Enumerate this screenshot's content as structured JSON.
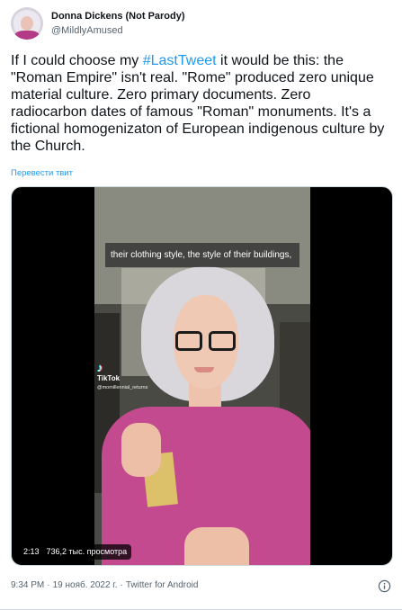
{
  "author": {
    "display_name": "Donna Dickens (Not Parody)",
    "handle": "@MildlyAmused"
  },
  "tweet": {
    "text_before": "If I could choose my ",
    "hashtag": "#LastTweet",
    "text_after": " it would be this: the \"Roman Empire\" isn't real. \"Rome\" produced zero unique material culture. Zero primary documents. Zero radiocarbon dates of famous \"Roman\" monuments. It's a fictional homogenizaton of European indigenous culture by the Church.",
    "translate_label": "Перевести твит"
  },
  "media": {
    "caption": "their clothing style, the style of their buildings,",
    "watermark_brand": "TikTok",
    "watermark_user": "@momillennial_returns",
    "duration": "2:13",
    "views": "736,2 тыс. просмотра"
  },
  "meta": {
    "time": "9:34 PM",
    "date": "19 нояб. 2022 г.",
    "source": "Twitter for Android"
  },
  "colors": {
    "link": "#1d9bf0",
    "secondary_text": "#536471",
    "text": "#0f1419"
  },
  "icons": {
    "info": "info-icon",
    "tiktok": "tiktok-icon"
  }
}
